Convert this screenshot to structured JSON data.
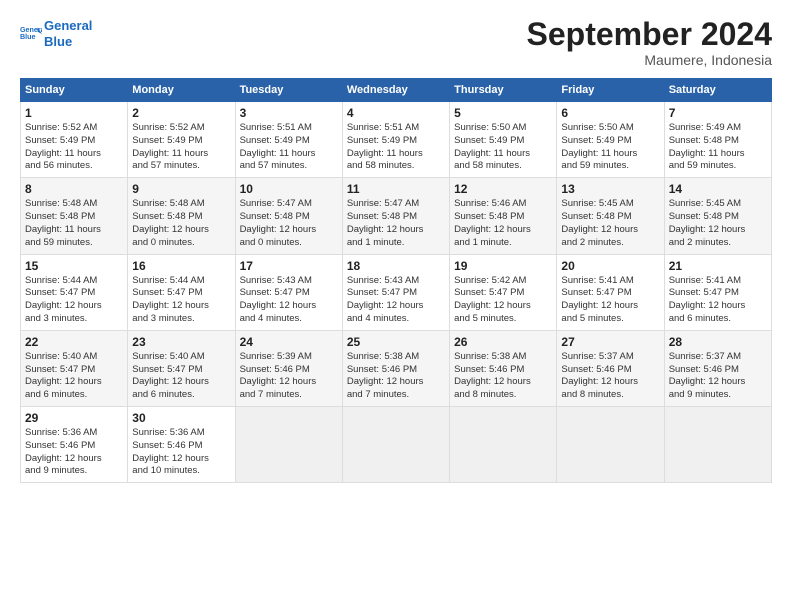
{
  "header": {
    "logo_line1": "General",
    "logo_line2": "Blue",
    "month": "September 2024",
    "location": "Maumere, Indonesia"
  },
  "days_of_week": [
    "Sunday",
    "Monday",
    "Tuesday",
    "Wednesday",
    "Thursday",
    "Friday",
    "Saturday"
  ],
  "weeks": [
    [
      {
        "day": "1",
        "info": "Sunrise: 5:52 AM\nSunset: 5:49 PM\nDaylight: 11 hours\nand 56 minutes."
      },
      {
        "day": "2",
        "info": "Sunrise: 5:52 AM\nSunset: 5:49 PM\nDaylight: 11 hours\nand 57 minutes."
      },
      {
        "day": "3",
        "info": "Sunrise: 5:51 AM\nSunset: 5:49 PM\nDaylight: 11 hours\nand 57 minutes."
      },
      {
        "day": "4",
        "info": "Sunrise: 5:51 AM\nSunset: 5:49 PM\nDaylight: 11 hours\nand 58 minutes."
      },
      {
        "day": "5",
        "info": "Sunrise: 5:50 AM\nSunset: 5:49 PM\nDaylight: 11 hours\nand 58 minutes."
      },
      {
        "day": "6",
        "info": "Sunrise: 5:50 AM\nSunset: 5:49 PM\nDaylight: 11 hours\nand 59 minutes."
      },
      {
        "day": "7",
        "info": "Sunrise: 5:49 AM\nSunset: 5:48 PM\nDaylight: 11 hours\nand 59 minutes."
      }
    ],
    [
      {
        "day": "8",
        "info": "Sunrise: 5:48 AM\nSunset: 5:48 PM\nDaylight: 11 hours\nand 59 minutes."
      },
      {
        "day": "9",
        "info": "Sunrise: 5:48 AM\nSunset: 5:48 PM\nDaylight: 12 hours\nand 0 minutes."
      },
      {
        "day": "10",
        "info": "Sunrise: 5:47 AM\nSunset: 5:48 PM\nDaylight: 12 hours\nand 0 minutes."
      },
      {
        "day": "11",
        "info": "Sunrise: 5:47 AM\nSunset: 5:48 PM\nDaylight: 12 hours\nand 1 minute."
      },
      {
        "day": "12",
        "info": "Sunrise: 5:46 AM\nSunset: 5:48 PM\nDaylight: 12 hours\nand 1 minute."
      },
      {
        "day": "13",
        "info": "Sunrise: 5:45 AM\nSunset: 5:48 PM\nDaylight: 12 hours\nand 2 minutes."
      },
      {
        "day": "14",
        "info": "Sunrise: 5:45 AM\nSunset: 5:48 PM\nDaylight: 12 hours\nand 2 minutes."
      }
    ],
    [
      {
        "day": "15",
        "info": "Sunrise: 5:44 AM\nSunset: 5:47 PM\nDaylight: 12 hours\nand 3 minutes."
      },
      {
        "day": "16",
        "info": "Sunrise: 5:44 AM\nSunset: 5:47 PM\nDaylight: 12 hours\nand 3 minutes."
      },
      {
        "day": "17",
        "info": "Sunrise: 5:43 AM\nSunset: 5:47 PM\nDaylight: 12 hours\nand 4 minutes."
      },
      {
        "day": "18",
        "info": "Sunrise: 5:43 AM\nSunset: 5:47 PM\nDaylight: 12 hours\nand 4 minutes."
      },
      {
        "day": "19",
        "info": "Sunrise: 5:42 AM\nSunset: 5:47 PM\nDaylight: 12 hours\nand 5 minutes."
      },
      {
        "day": "20",
        "info": "Sunrise: 5:41 AM\nSunset: 5:47 PM\nDaylight: 12 hours\nand 5 minutes."
      },
      {
        "day": "21",
        "info": "Sunrise: 5:41 AM\nSunset: 5:47 PM\nDaylight: 12 hours\nand 6 minutes."
      }
    ],
    [
      {
        "day": "22",
        "info": "Sunrise: 5:40 AM\nSunset: 5:47 PM\nDaylight: 12 hours\nand 6 minutes."
      },
      {
        "day": "23",
        "info": "Sunrise: 5:40 AM\nSunset: 5:47 PM\nDaylight: 12 hours\nand 6 minutes."
      },
      {
        "day": "24",
        "info": "Sunrise: 5:39 AM\nSunset: 5:46 PM\nDaylight: 12 hours\nand 7 minutes."
      },
      {
        "day": "25",
        "info": "Sunrise: 5:38 AM\nSunset: 5:46 PM\nDaylight: 12 hours\nand 7 minutes."
      },
      {
        "day": "26",
        "info": "Sunrise: 5:38 AM\nSunset: 5:46 PM\nDaylight: 12 hours\nand 8 minutes."
      },
      {
        "day": "27",
        "info": "Sunrise: 5:37 AM\nSunset: 5:46 PM\nDaylight: 12 hours\nand 8 minutes."
      },
      {
        "day": "28",
        "info": "Sunrise: 5:37 AM\nSunset: 5:46 PM\nDaylight: 12 hours\nand 9 minutes."
      }
    ],
    [
      {
        "day": "29",
        "info": "Sunrise: 5:36 AM\nSunset: 5:46 PM\nDaylight: 12 hours\nand 9 minutes."
      },
      {
        "day": "30",
        "info": "Sunrise: 5:36 AM\nSunset: 5:46 PM\nDaylight: 12 hours\nand 10 minutes."
      },
      {
        "day": "",
        "info": ""
      },
      {
        "day": "",
        "info": ""
      },
      {
        "day": "",
        "info": ""
      },
      {
        "day": "",
        "info": ""
      },
      {
        "day": "",
        "info": ""
      }
    ]
  ]
}
